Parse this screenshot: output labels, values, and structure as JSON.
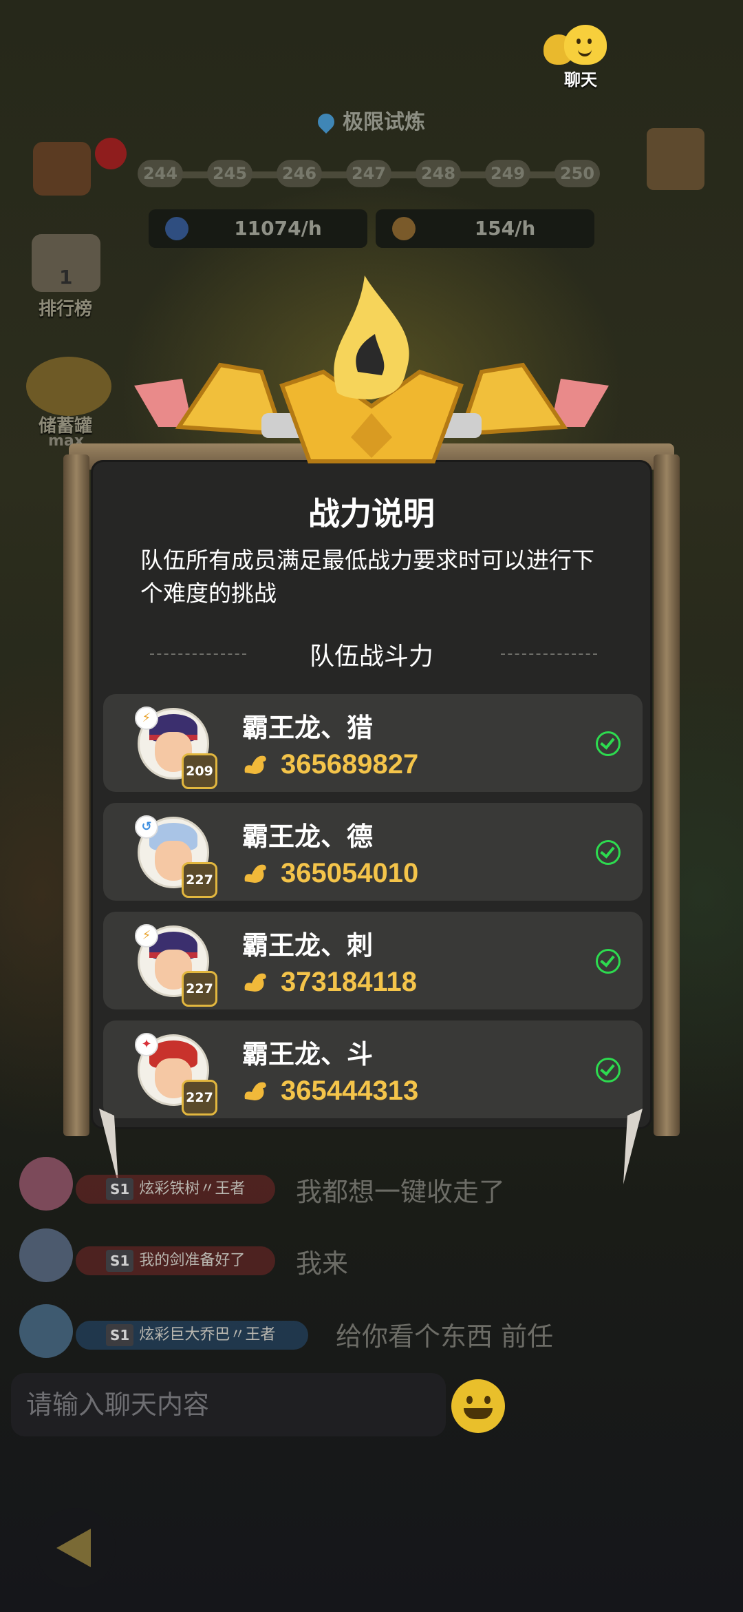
{
  "top": {
    "chat_label": "聊天",
    "stage_title": "极限试炼",
    "progress_levels": [
      "244",
      "245",
      "246",
      "247",
      "248",
      "249",
      "250"
    ],
    "rate_moon": "11074/h",
    "rate_coin": "154/h"
  },
  "left_menu": {
    "rank_number": "1",
    "rank_label": "排行榜",
    "jar_label": "储蓄罐",
    "jar_badge": "max"
  },
  "modal": {
    "title": "战力说明",
    "description": "队伍所有成员满足最低战力要求时可以进行下个难度的挑战",
    "section_title": "队伍战斗力",
    "members": [
      {
        "name": "霸王龙、猎",
        "level": "209",
        "power": "365689827",
        "element_color": "#e8a12a",
        "hair_color": "#3b2f6e"
      },
      {
        "name": "霸王龙、德",
        "level": "227",
        "power": "365054010",
        "element_color": "#3f8fe0",
        "hair_color": "#a9c4e6"
      },
      {
        "name": "霸王龙、刺",
        "level": "227",
        "power": "373184118",
        "element_color": "#e8a12a",
        "hair_color": "#3b2f6e"
      },
      {
        "name": "霸王龙、斗",
        "level": "227",
        "power": "365444313",
        "element_color": "#d9323a",
        "hair_color": "#c8322c"
      }
    ]
  },
  "chat": {
    "messages": [
      {
        "sender": "炫彩铁树〃王者",
        "server": "S1",
        "text": "我都想一键收走了"
      },
      {
        "sender": "我的剑准备好了",
        "server": "S1",
        "text": "我来"
      },
      {
        "sender": "炫彩巨大乔巴〃王者",
        "server": "S1",
        "text": "给你看个东西 前任"
      }
    ],
    "input_placeholder": "请输入聊天内容"
  },
  "colors": {
    "power_gold": "#f4c44a",
    "check_green": "#2ddb4f",
    "panel_bg": "#262625",
    "row_bg": "#393937"
  }
}
